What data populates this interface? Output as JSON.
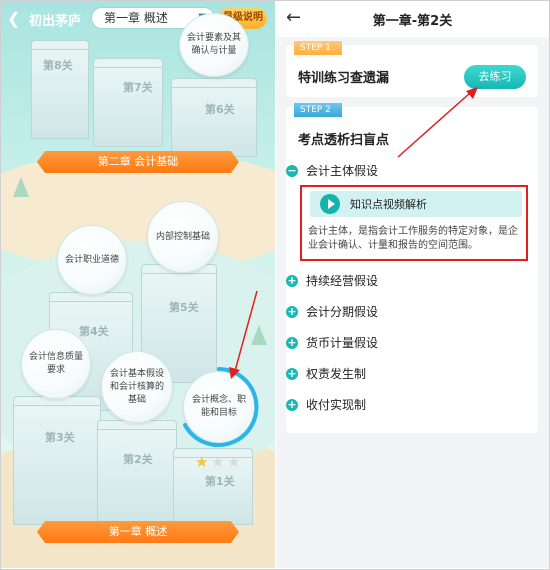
{
  "left": {
    "title": "初出茅庐",
    "chapter_select": "第一章 概述",
    "star_button": "星级说明",
    "levels": {
      "l8": "第8关",
      "l7": "第7关",
      "l6": "第6关",
      "l5": "第5关",
      "l4": "第4关",
      "l3": "第3关",
      "l2": "第2关",
      "l1": "第1关"
    },
    "bubbles": {
      "b6": "会计要素及其确认与计量",
      "b5": "内部控制基础",
      "b4": "会计职业道德",
      "b3": "会计信息质量要求",
      "b2": "会计基本假设和会计核算的基础",
      "b1": "会计概念、职能和目标"
    },
    "banners": {
      "chapter2": "第二章 会计基础",
      "chapter1": "第一章 概述"
    },
    "colors": {
      "accent_orange": "#ff7a13",
      "progress_ring": "#29b6e8"
    }
  },
  "right": {
    "header_title": "第一章-第2关",
    "step1": {
      "tag": "STEP 1",
      "title": "特训练习查遗漏",
      "button": "去练习"
    },
    "step2": {
      "tag": "STEP 2",
      "title": "考点透析扫盲点",
      "topics": [
        "会计主体假设",
        "持续经营假设",
        "会计分期假设",
        "货币计量假设",
        "权责发生制",
        "收付实现制"
      ],
      "video_label": "知识点视频解析",
      "description": "会计主体，是指会计工作服务的特定对象，是企业会计确认、计量和报告的空间范围。"
    },
    "colors": {
      "teal": "#16b7b4",
      "highlight_red": "#e02020"
    }
  }
}
